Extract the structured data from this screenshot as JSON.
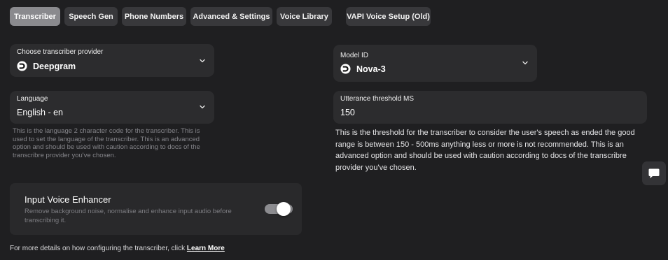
{
  "tabs": [
    {
      "label": "Transcriber",
      "active": true
    },
    {
      "label": "Speech Gen"
    },
    {
      "label": "Phone Numbers"
    },
    {
      "label": "Advanced & Settings"
    },
    {
      "label": "Voice Library"
    },
    {
      "label": "VAPI Voice Setup (Old)"
    }
  ],
  "provider": {
    "label": "Choose transcriber provider",
    "value": "Deepgram",
    "icon": "deepgram-icon"
  },
  "model": {
    "label": "Model ID",
    "value": "Nova-3",
    "icon": "deepgram-icon"
  },
  "language": {
    "label": "Language",
    "value": "English - en",
    "help": "This is the language 2 character code for the transcriber. This is used to set the language of the transcriber. This is an advanced option and should be used with caution according to docs of the transcribre provider you've chosen."
  },
  "utterance": {
    "label": "Utterance threshold MS",
    "value": "150",
    "help": "This is the threshold for the transcriber to consider the user's speech as ended the good range is between 150 - 500ms anything less or more is not recommended. This is an advanced option and should be used with caution according to docs of the transcribre provider you've chosen."
  },
  "enhancer": {
    "title": "Input Voice Enhancer",
    "description": "Remove background noise, normalise and enhance input audio before transcribing it.",
    "enabled": true
  },
  "footer": {
    "text": "For more details on how configuring the transcriber, click",
    "link": "Learn More"
  },
  "chat": {
    "icon": "chat-bubble-icon"
  },
  "colors": {
    "background": "#1f1f21",
    "field": "#2c2c2e",
    "tab": "#38383b",
    "tab_active": "#8a8a8e"
  }
}
